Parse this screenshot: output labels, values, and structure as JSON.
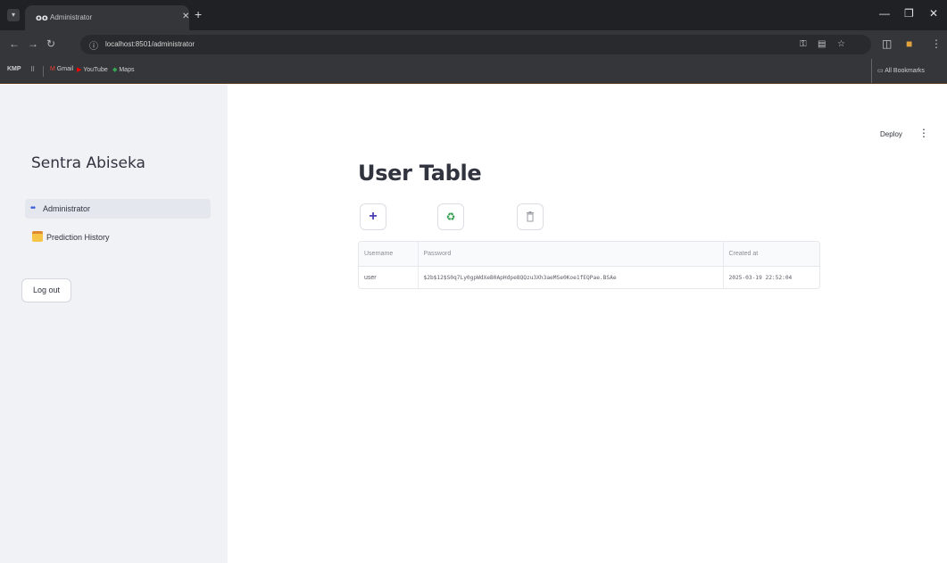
{
  "browser": {
    "tab_search_icon": "chevron-down",
    "tab_favicon": "oo",
    "tab_title": "Administrator",
    "url": "localhost:8501/administrator",
    "bookmarks": [
      {
        "label": "Gmail"
      },
      {
        "label": "YouTube"
      },
      {
        "label": "Maps"
      }
    ],
    "all_bookmarks_label": "All Bookmarks"
  },
  "sidebar": {
    "brand": "Sentra Abiseka",
    "items": [
      {
        "label": "Administrator",
        "icon": "double-dot-icon",
        "active": true
      },
      {
        "label": "Prediction History",
        "icon": "calendar-icon",
        "active": false
      }
    ],
    "logout_label": "Log out"
  },
  "header": {
    "deploy_label": "Deploy",
    "menu_glyph": "⋮"
  },
  "main": {
    "title": "User Table",
    "actions": [
      {
        "name": "add",
        "glyph": "+",
        "color": "#4a3fb5"
      },
      {
        "name": "refresh",
        "glyph": "♻",
        "color": "#2e9b4d"
      },
      {
        "name": "delete",
        "glyph": "🗑",
        "color": "#8a8c94"
      }
    ],
    "table": {
      "columns": [
        "Username",
        "Password",
        "Created at"
      ],
      "rows": [
        {
          "username": "user",
          "password": "$2b$12$S0q7Ly0gpWdXeB0ApHdpe8QQzu3Xh3aeMSe0Koe1fEQPae.BSAe",
          "created_at": "2025-03-19 22:52:04"
        }
      ]
    }
  }
}
